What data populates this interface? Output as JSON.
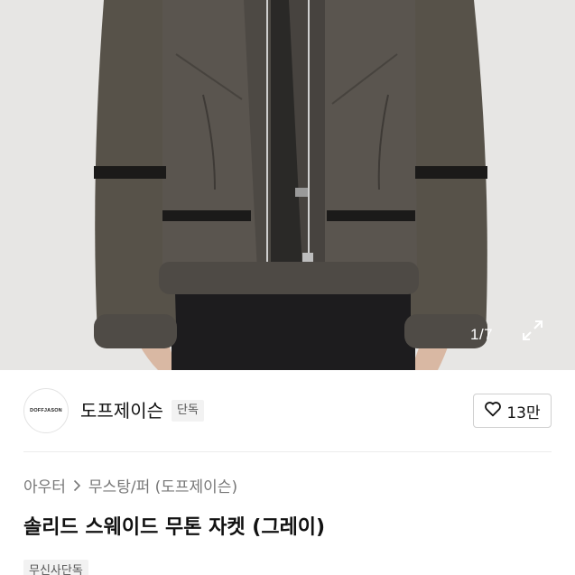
{
  "gallery": {
    "counter": "1/7",
    "icons": {
      "expand": "expand-arrows-icon"
    }
  },
  "brand": {
    "logo_text": "DOFFJASON",
    "name": "도프제이슨",
    "tag": "단독",
    "likes": "13만",
    "icons": {
      "like": "heart-outline-icon"
    }
  },
  "breadcrumb": {
    "items": [
      "아우터",
      "무스탕/퍼 (도프제이슨)"
    ],
    "icons": {
      "separator": "chevron-right-icon"
    }
  },
  "product": {
    "title": "솔리드 스웨이드 무톤 자켓 (그레이)",
    "label": "무신사단독"
  },
  "colors": {
    "jacket": "#54504b",
    "fur": "#4e4a45",
    "background": "#e7e6e4"
  }
}
